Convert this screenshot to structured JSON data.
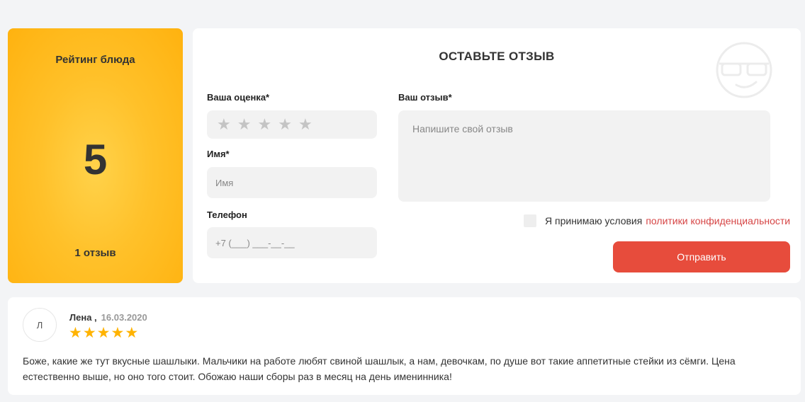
{
  "rating_card": {
    "title": "Рейтинг блюда",
    "value": "5",
    "count": "1 отзыв"
  },
  "form": {
    "title": "ОСТАВЬТЕ ОТЗЫВ",
    "rating_label": "Ваша оценка*",
    "rating_stars_total": 5,
    "name_label": "Имя*",
    "name_placeholder": "Имя",
    "phone_label": "Телефон",
    "phone_placeholder": "+7 (___) ___-__-__",
    "review_label": "Ваш отзыв*",
    "review_placeholder": "Напишите свой отзыв",
    "consent_text": "Я принимаю условия",
    "consent_link": "политики конфиденциальности",
    "submit_label": "Отправить"
  },
  "review": {
    "avatar_letter": "Л",
    "author": "Лена ,",
    "date": "16.03.2020",
    "stars": 5,
    "text": "Боже, какие же тут вкусные шашлыки. Мальчики на работе любят свиной шашлык, а нам, девочкам, по душе вот такие аппетитные стейки из сёмги. Цена естественно выше, но оно того стоит. Обожаю наши сборы раз в месяц на день именинника!"
  },
  "colors": {
    "accent_yellow": "#ffb20f",
    "button_red": "#e74c3c",
    "link_red": "#d64545",
    "star_gold": "#ffb300"
  },
  "icons": {
    "mascot": "sunglasses-smiley-icon",
    "empty_star": "star-outline-icon",
    "filled_star": "star-filled-icon"
  }
}
